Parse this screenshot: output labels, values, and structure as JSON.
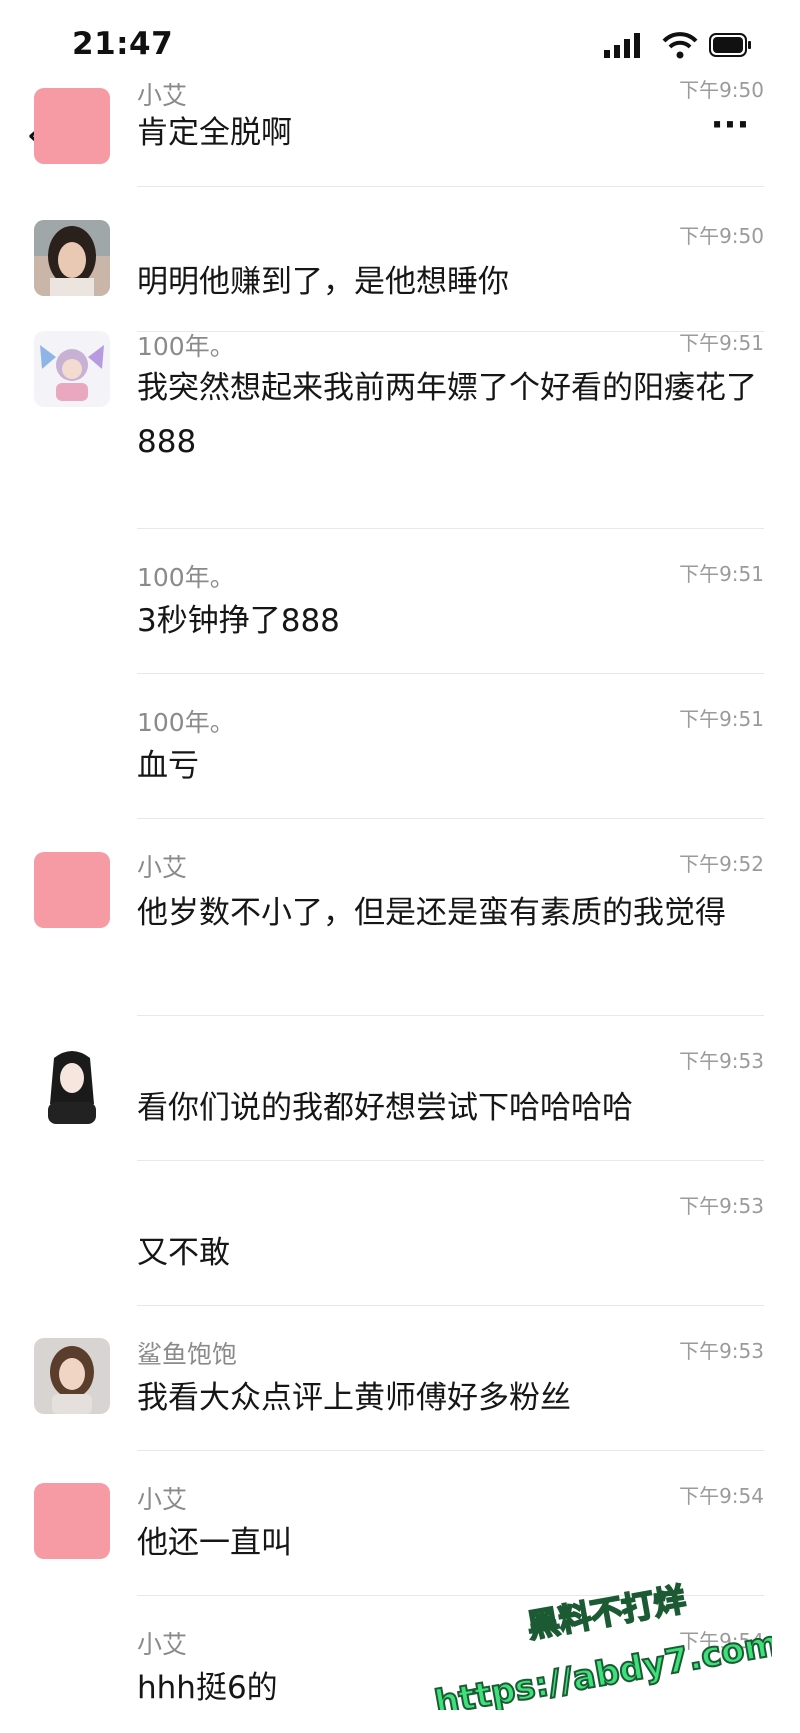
{
  "status_bar": {
    "time": "21:47"
  },
  "nav": {
    "back_icon": "chevron-left-icon",
    "more_icon": "more-dots-icon"
  },
  "messages": [
    {
      "name": "小艾",
      "time": "下午9:50",
      "text": "肯定全脱啊",
      "avatar": "pink"
    },
    {
      "name": "",
      "time": "下午9:50",
      "text": "明明他赚到了，是他想睡你",
      "avatar": "woman-photo"
    },
    {
      "name": "100年。",
      "time": "下午9:51",
      "text": "我突然想起来我前两年嫖了个好看的阳痿花了888",
      "avatar": "butterfly-girl-illustration"
    },
    {
      "name": "100年。",
      "time": "下午9:51",
      "text": "3秒钟挣了888",
      "avatar": ""
    },
    {
      "name": "100年。",
      "time": "下午9:51",
      "text": "血亏",
      "avatar": ""
    },
    {
      "name": "小艾",
      "time": "下午9:52",
      "text": "他岁数不小了，但是还是蛮有素质的我觉得",
      "avatar": "pink"
    },
    {
      "name": "",
      "time": "下午9:53",
      "text": "看你们说的我都好想尝试下哈哈哈哈",
      "avatar": "black-hair-girl-illustration"
    },
    {
      "name": "",
      "time": "下午9:53",
      "text": "又不敢",
      "avatar": ""
    },
    {
      "name": "鲨鱼饱饱",
      "time": "下午9:53",
      "text": "我看大众点评上黄师傅好多粉丝",
      "avatar": "girl-photo"
    },
    {
      "name": "小艾",
      "time": "下午9:54",
      "text": "他还一直叫",
      "avatar": "pink"
    },
    {
      "name": "小艾",
      "time": "下午9:54",
      "text": "hhh挺6的",
      "avatar": ""
    }
  ],
  "watermark": {
    "line1": "黑料不打烊",
    "line2": "https://abdy7.com"
  },
  "colors": {
    "pink_avatar": "#f69aa4",
    "watermark_green": "#3ee07a"
  }
}
